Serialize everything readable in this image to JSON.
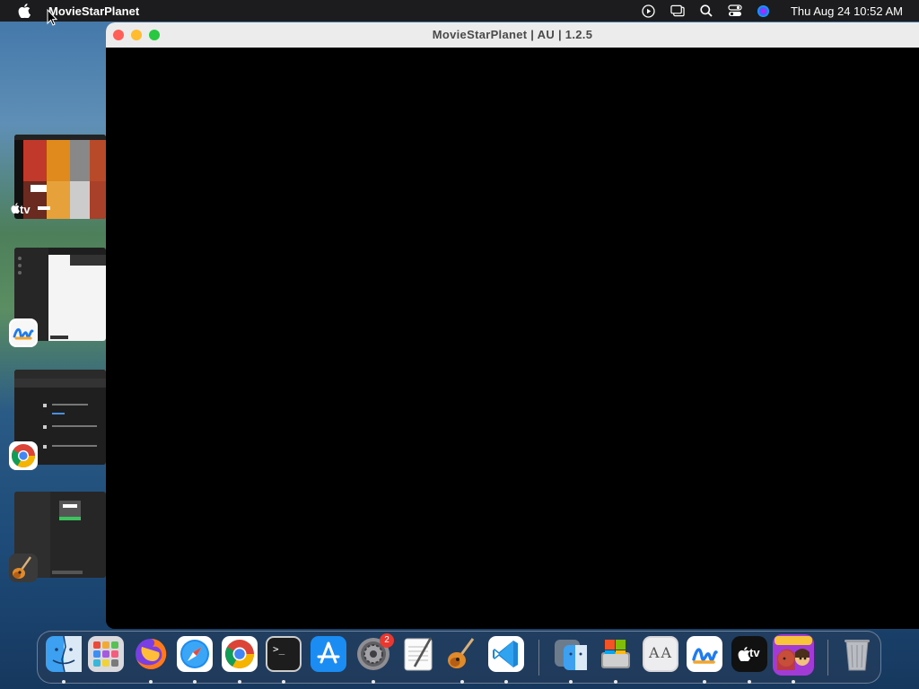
{
  "menubar": {
    "app_name": "MovieStarPlanet",
    "clock": "Thu Aug 24  10:52 AM",
    "icons": [
      "apple-icon",
      "screen-record-icon",
      "stage-manager-icon",
      "spotlight-icon",
      "control-center-icon",
      "siri-icon"
    ]
  },
  "window": {
    "title": "MovieStarPlanet   |   AU   |   1.2.5"
  },
  "stage_manager": {
    "groups": [
      {
        "app": "Apple TV",
        "icon": "apple-tv-icon",
        "label": "tv"
      },
      {
        "app": "Freeform",
        "icon": "freeform-icon"
      },
      {
        "app": "Google Chrome",
        "icon": "chrome-icon"
      },
      {
        "app": "GarageBand",
        "icon": "garageband-icon"
      }
    ]
  },
  "dock": {
    "items": [
      {
        "name": "Finder",
        "icon": "finder-icon"
      },
      {
        "name": "Launchpad",
        "icon": "launchpad-icon"
      },
      {
        "name": "Firefox",
        "icon": "firefox-icon"
      },
      {
        "name": "Safari",
        "icon": "safari-icon"
      },
      {
        "name": "Google Chrome",
        "icon": "chrome-icon"
      },
      {
        "name": "Terminal",
        "icon": "terminal-icon",
        "glyph": ">_"
      },
      {
        "name": "App Store",
        "icon": "app-store-icon"
      },
      {
        "name": "System Settings",
        "icon": "system-settings-icon",
        "badge": "2"
      },
      {
        "name": "TextEdit",
        "icon": "textedit-icon"
      },
      {
        "name": "GarageBand",
        "icon": "garageband-icon"
      },
      {
        "name": "Visual Studio Code",
        "icon": "vscode-icon"
      },
      {
        "name": "Finder Utility",
        "icon": "migration-icon"
      },
      {
        "name": "Boot Camp",
        "icon": "bootcamp-icon"
      },
      {
        "name": "Font Book",
        "icon": "font-book-icon",
        "glyph": "AA"
      },
      {
        "name": "Freeform",
        "icon": "freeform-icon"
      },
      {
        "name": "Apple TV",
        "icon": "apple-tv-icon",
        "glyph": "tv"
      },
      {
        "name": "MovieStarPlanet",
        "icon": "moviestarplanet-icon"
      },
      {
        "name": "Trash",
        "icon": "trash-icon"
      }
    ]
  }
}
